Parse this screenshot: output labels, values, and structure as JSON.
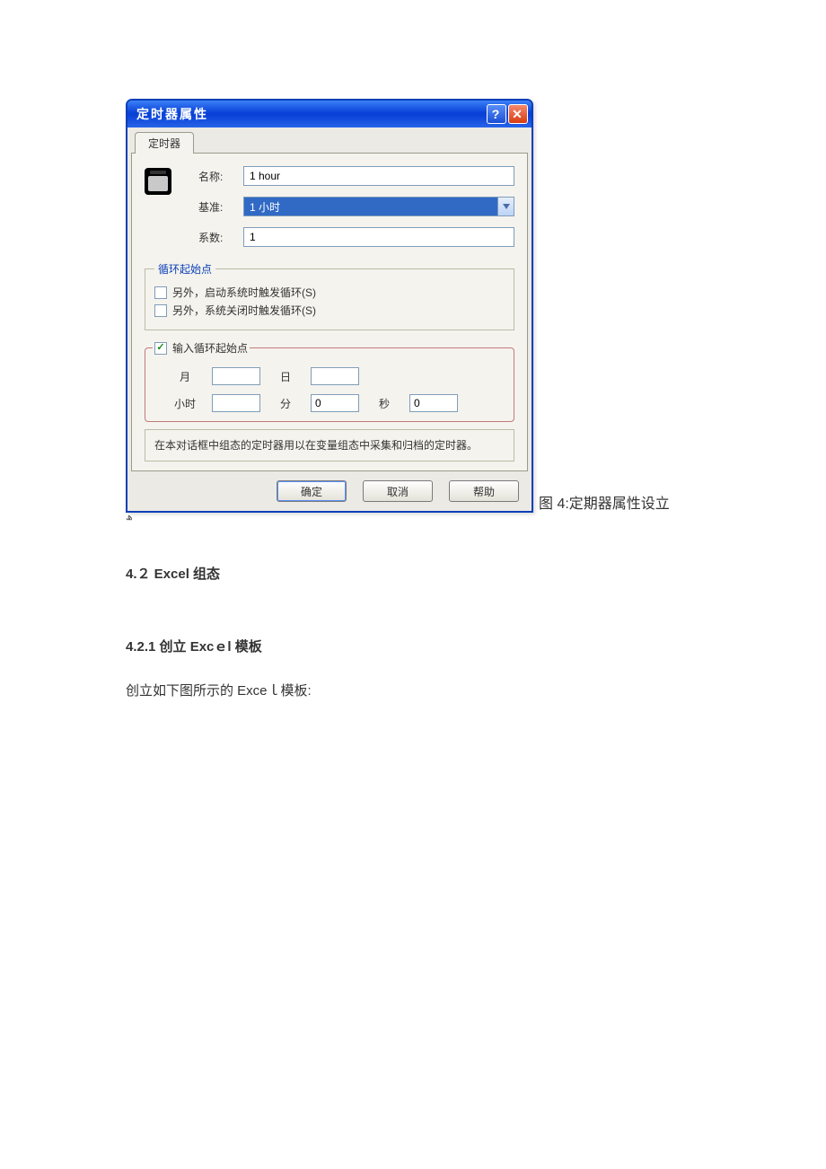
{
  "dialog": {
    "title": "定时器属性",
    "tab_label": "定时器",
    "fields": {
      "name_label": "名称:",
      "name_value": "1 hour",
      "base_label": "基准:",
      "base_value": "1 小时",
      "factor_label": "系数:",
      "factor_value": "1"
    },
    "cycle": {
      "legend": "循环起始点",
      "chk_start_label": "另外，启动系统时触发循环(S)",
      "chk_close_label": "另外，系统关闭时触发循环(S)"
    },
    "datetime": {
      "legend_label": "输入循环起始点",
      "month": "月",
      "day": "日",
      "hour": "小时",
      "minute": "分",
      "second": "秒",
      "month_val": "",
      "day_val": "",
      "hour_val": "",
      "minute_val": "0",
      "second_val": "0"
    },
    "info_text": "在本对话框中组态的定时器用以在变量组态中采集和归档的定时器。",
    "buttons": {
      "ok": "确定",
      "cancel": "取消",
      "help": "帮助"
    }
  },
  "caption": "图 4:定期器属性设立",
  "doc": {
    "sec42": "4.２  Excel 组态",
    "sec421": "4.2.1  创立 Excｅl 模板",
    "body421": "创立如下图所示的 Exceｌ模板:"
  }
}
